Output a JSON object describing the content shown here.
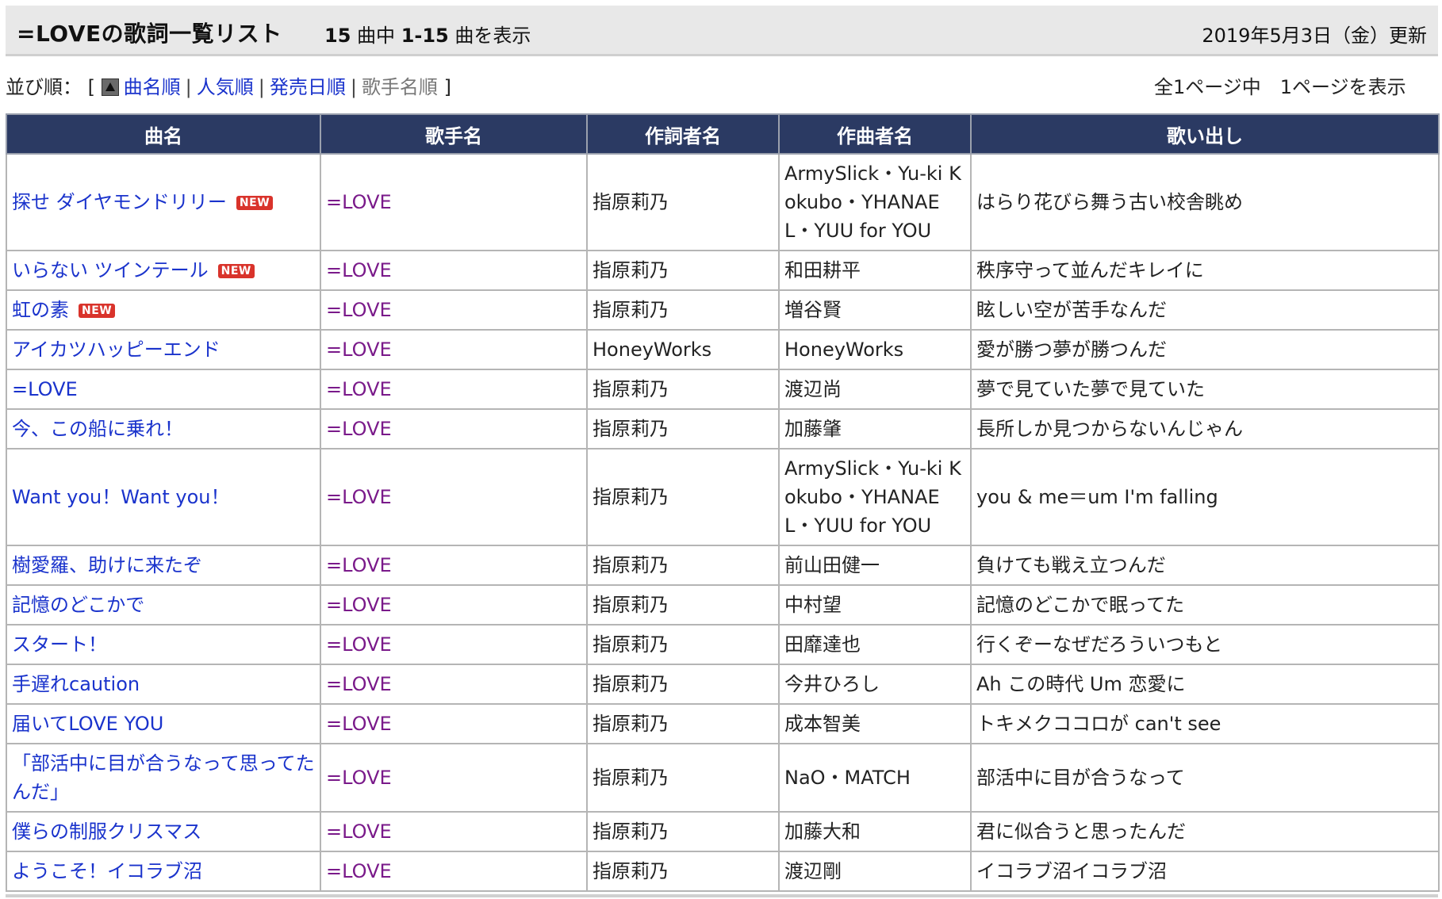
{
  "header": {
    "title": "=LOVEの歌詞一覧リスト",
    "count_total": "15",
    "count_middle": "曲中",
    "count_range": "1-15",
    "count_suffix": "曲を表示",
    "updated": "2019年5月3日（金）更新"
  },
  "sort": {
    "label": "並び順：",
    "open": "[",
    "close": "]",
    "options": [
      "曲名順",
      "人気順",
      "発売日順",
      "歌手名順"
    ],
    "current": "歌手名順"
  },
  "pagination": {
    "text": "全1ページ中　1ページを表示"
  },
  "table": {
    "headers": [
      "曲名",
      "歌手名",
      "作詞者名",
      "作曲者名",
      "歌い出し"
    ],
    "rows": [
      {
        "title": "探せ ダイヤモンドリリー",
        "new": "NEW",
        "artist": "=LOVE",
        "lyricist": "指原莉乃",
        "composer": "ArmySlick・Yu-ki Kokubo・YHANAEL・YUU for YOU",
        "opening": "はらり花びら舞う古い校舎眺め"
      },
      {
        "title": "いらない ツインテール",
        "new": "NEW",
        "artist": "=LOVE",
        "lyricist": "指原莉乃",
        "composer": "和田耕平",
        "opening": "秩序守って並んだキレイに"
      },
      {
        "title": "虹の素",
        "new": "NEW",
        "artist": "=LOVE",
        "lyricist": "指原莉乃",
        "composer": "増谷賢",
        "opening": "眩しい空が苦手なんだ"
      },
      {
        "title": "アイカツハッピーエンド",
        "new": "",
        "artist": "=LOVE",
        "lyricist": "HoneyWorks",
        "composer": "HoneyWorks",
        "opening": "愛が勝つ夢が勝つんだ"
      },
      {
        "title": "=LOVE",
        "new": "",
        "artist": "=LOVE",
        "lyricist": "指原莉乃",
        "composer": "渡辺尚",
        "opening": "夢で見ていた夢で見ていた"
      },
      {
        "title": "今、この船に乗れ！",
        "new": "",
        "artist": "=LOVE",
        "lyricist": "指原莉乃",
        "composer": "加藤肇",
        "opening": "長所しか見つからないんじゃん"
      },
      {
        "title": "Want you！Want you！",
        "new": "",
        "artist": "=LOVE",
        "lyricist": "指原莉乃",
        "composer": "ArmySlick・Yu-ki Kokubo・YHANAEL・YUU for YOU",
        "opening": "you & me＝um I'm falling"
      },
      {
        "title": "樹愛羅、助けに来たぞ",
        "new": "",
        "artist": "=LOVE",
        "lyricist": "指原莉乃",
        "composer": "前山田健一",
        "opening": "負けても戦え立つんだ"
      },
      {
        "title": "記憶のどこかで",
        "new": "",
        "artist": "=LOVE",
        "lyricist": "指原莉乃",
        "composer": "中村望",
        "opening": "記憶のどこかで眠ってた"
      },
      {
        "title": "スタート！",
        "new": "",
        "artist": "=LOVE",
        "lyricist": "指原莉乃",
        "composer": "田靡達也",
        "opening": "行くぞーなぜだろういつもと"
      },
      {
        "title": "手遅れcaution",
        "new": "",
        "artist": "=LOVE",
        "lyricist": "指原莉乃",
        "composer": "今井ひろし",
        "opening": "Ah この時代 Um 恋愛に"
      },
      {
        "title": "届いてLOVE YOU",
        "new": "",
        "artist": "=LOVE",
        "lyricist": "指原莉乃",
        "composer": "成本智美",
        "opening": "トキメクココロが can't see"
      },
      {
        "title": "「部活中に目が合うなって思ってたんだ」",
        "new": "",
        "artist": "=LOVE",
        "lyricist": "指原莉乃",
        "composer": "NaO・MATCH",
        "opening": "部活中に目が合うなって"
      },
      {
        "title": "僕らの制服クリスマス",
        "new": "",
        "artist": "=LOVE",
        "lyricist": "指原莉乃",
        "composer": "加藤大和",
        "opening": "君に似合うと思ったんだ"
      },
      {
        "title": "ようこそ！イコラブ沼",
        "new": "",
        "artist": "=LOVE",
        "lyricist": "指原莉乃",
        "composer": "渡辺剛",
        "opening": "イコラブ沼イコラブ沼"
      }
    ]
  }
}
